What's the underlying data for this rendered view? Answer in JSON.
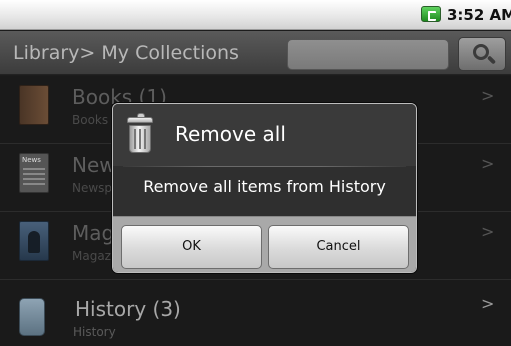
{
  "status_bar": {
    "time": "3:52 AM"
  },
  "header": {
    "breadcrumb": "Library> My Collections"
  },
  "list": [
    {
      "name": "Books (1)",
      "sub": "Books",
      "icon": "book-icon"
    },
    {
      "name": "New",
      "sub": "Newsp",
      "icon": "newspaper-icon",
      "icon_label": "News"
    },
    {
      "name": "Mag",
      "sub": "Magaz",
      "icon": "magazine-icon"
    },
    {
      "name": "History (3)",
      "sub": "History",
      "icon": "history-icon"
    }
  ],
  "chevron": ">",
  "dialog": {
    "title": "Remove all",
    "message": "Remove all items from History",
    "ok_label": "OK",
    "cancel_label": "Cancel",
    "icon": "trash-icon"
  }
}
